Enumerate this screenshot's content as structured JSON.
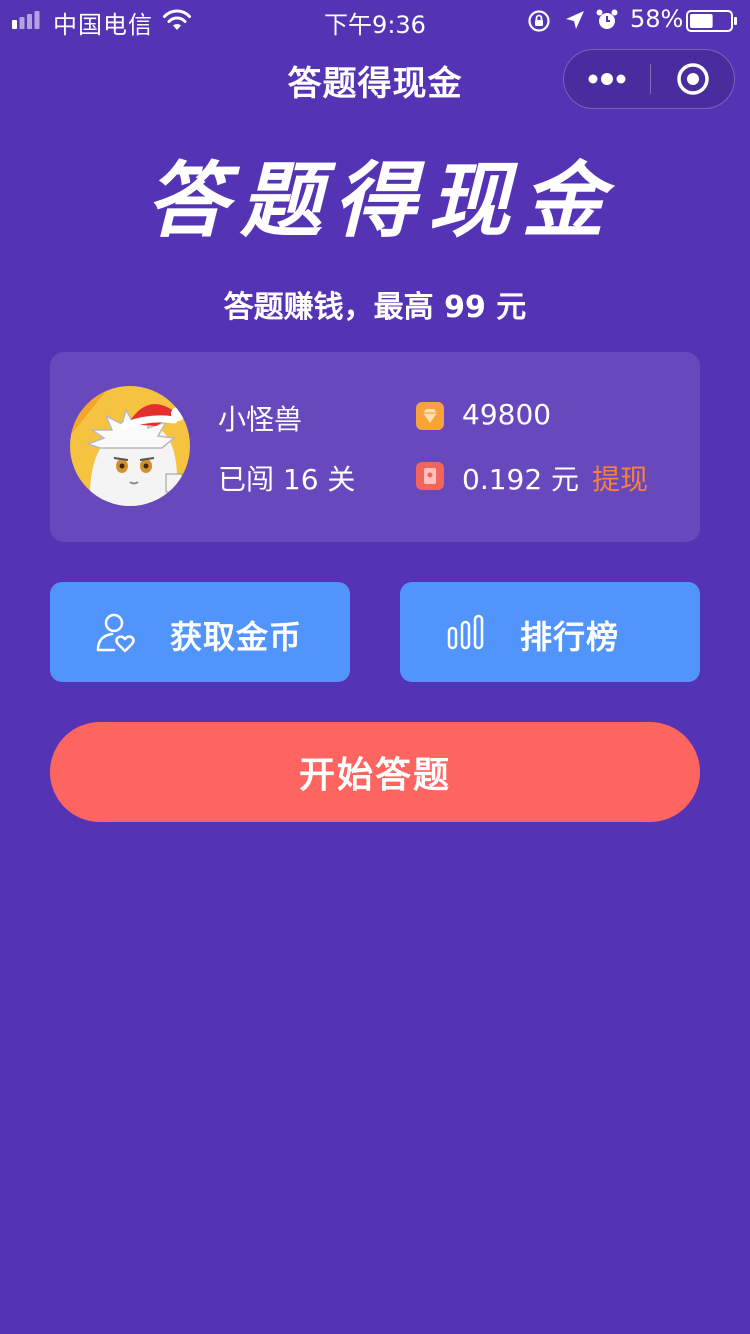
{
  "status_bar": {
    "carrier": "中国电信",
    "time": "下午9:36",
    "battery": "58%",
    "battery_level": 0.58
  },
  "nav": {
    "title": "答题得现金"
  },
  "hero": {
    "title": "答题得现金",
    "subtitle": "答题赚钱，最高 99 元"
  },
  "user": {
    "name": "小怪兽",
    "levels_passed": "已闯 16 关",
    "coins": "49800",
    "cash": "0.192 元",
    "withdraw_label": "提现"
  },
  "actions": {
    "get_coins_label": "获取金币",
    "leaderboard_label": "排行榜",
    "start_label": "开始答题"
  },
  "colors": {
    "background": "#5434B5",
    "card": "#6749BD",
    "blue_button": "#5094FC",
    "start_button": "#FE6561",
    "withdraw": "#F7803B",
    "coin_icon": "#F8A23C",
    "cash_icon": "#F2645C"
  },
  "icons": {
    "signal": "signal-icon",
    "wifi": "wifi-icon",
    "orientation_lock": "orientation-lock-icon",
    "location": "location-arrow-icon",
    "alarm": "alarm-icon",
    "battery": "battery-icon",
    "more": "more-dots-icon",
    "close": "target-close-icon",
    "coin": "diamond-coin-icon",
    "cash": "red-packet-icon",
    "get_coins": "user-heart-icon",
    "leaderboard": "bar-chart-icon"
  }
}
